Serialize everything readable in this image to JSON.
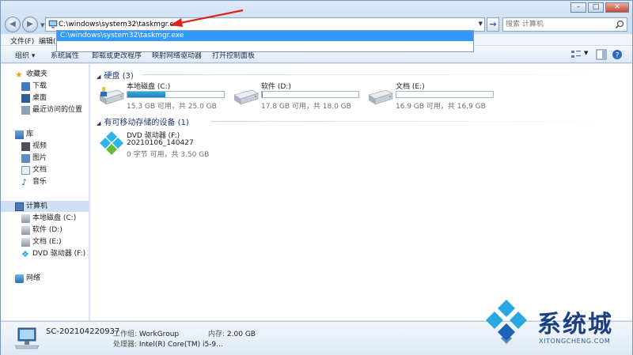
{
  "address": {
    "value": "C:\\windows\\system32\\taskmgr.exe",
    "suggestion": "C:\\windows\\system32\\taskmgr.exe"
  },
  "search": {
    "placeholder": "搜索 计算机"
  },
  "menu": {
    "file": "文件(F)",
    "edit": "编辑(E)"
  },
  "toolbar": {
    "organize": "组织 ▾",
    "system_props": "系统属性",
    "uninstall": "卸载或更改程序",
    "map_drive": "映射网络驱动器",
    "control_panel": "打开控制面板"
  },
  "nav": {
    "favorites": "收藏夹",
    "downloads": "下载",
    "desktop": "桌面",
    "recent": "最近访问的位置",
    "libraries": "库",
    "videos": "视频",
    "pictures": "图片",
    "documents": "文档",
    "music": "音乐",
    "computer": "计算机",
    "local_c": "本地磁盘 (C:)",
    "soft_d": "软件 (D:)",
    "docs_e": "文档 (E:)",
    "dvd_f": "DVD 驱动器 (F:) 20",
    "network": "网络"
  },
  "groups": {
    "hdd": "硬盘 (3)",
    "removable": "有可移动存储的设备 (1)"
  },
  "drives": [
    {
      "name": "本地磁盘 (C:)",
      "sub": "15.3 GB 可用，共 25.0 GB",
      "used_fraction": 0.39
    },
    {
      "name": "软件 (D:)",
      "sub": "17.8 GB 可用，共 18.0 GB",
      "used_fraction": 0.01
    },
    {
      "name": "文档 (E:)",
      "sub": "16.9 GB 可用，共 16.9 GB",
      "used_fraction": 0.0
    }
  ],
  "dvd": {
    "name": "DVD 驱动器 (F:)",
    "label": "20210106_140427",
    "sub": "0 字节 可用，共 3.50 GB"
  },
  "details": {
    "computer_name": "SC-202104220937",
    "workgroup_label": "工作组:",
    "workgroup": "WorkGroup",
    "memory_label": "内存:",
    "memory": "2.00 GB",
    "cpu_label": "处理器:",
    "cpu": "Intel(R) Core(TM) i5-9..."
  },
  "watermark": {
    "brand": "系统城",
    "sub": "XITONGCHENG.COM"
  }
}
